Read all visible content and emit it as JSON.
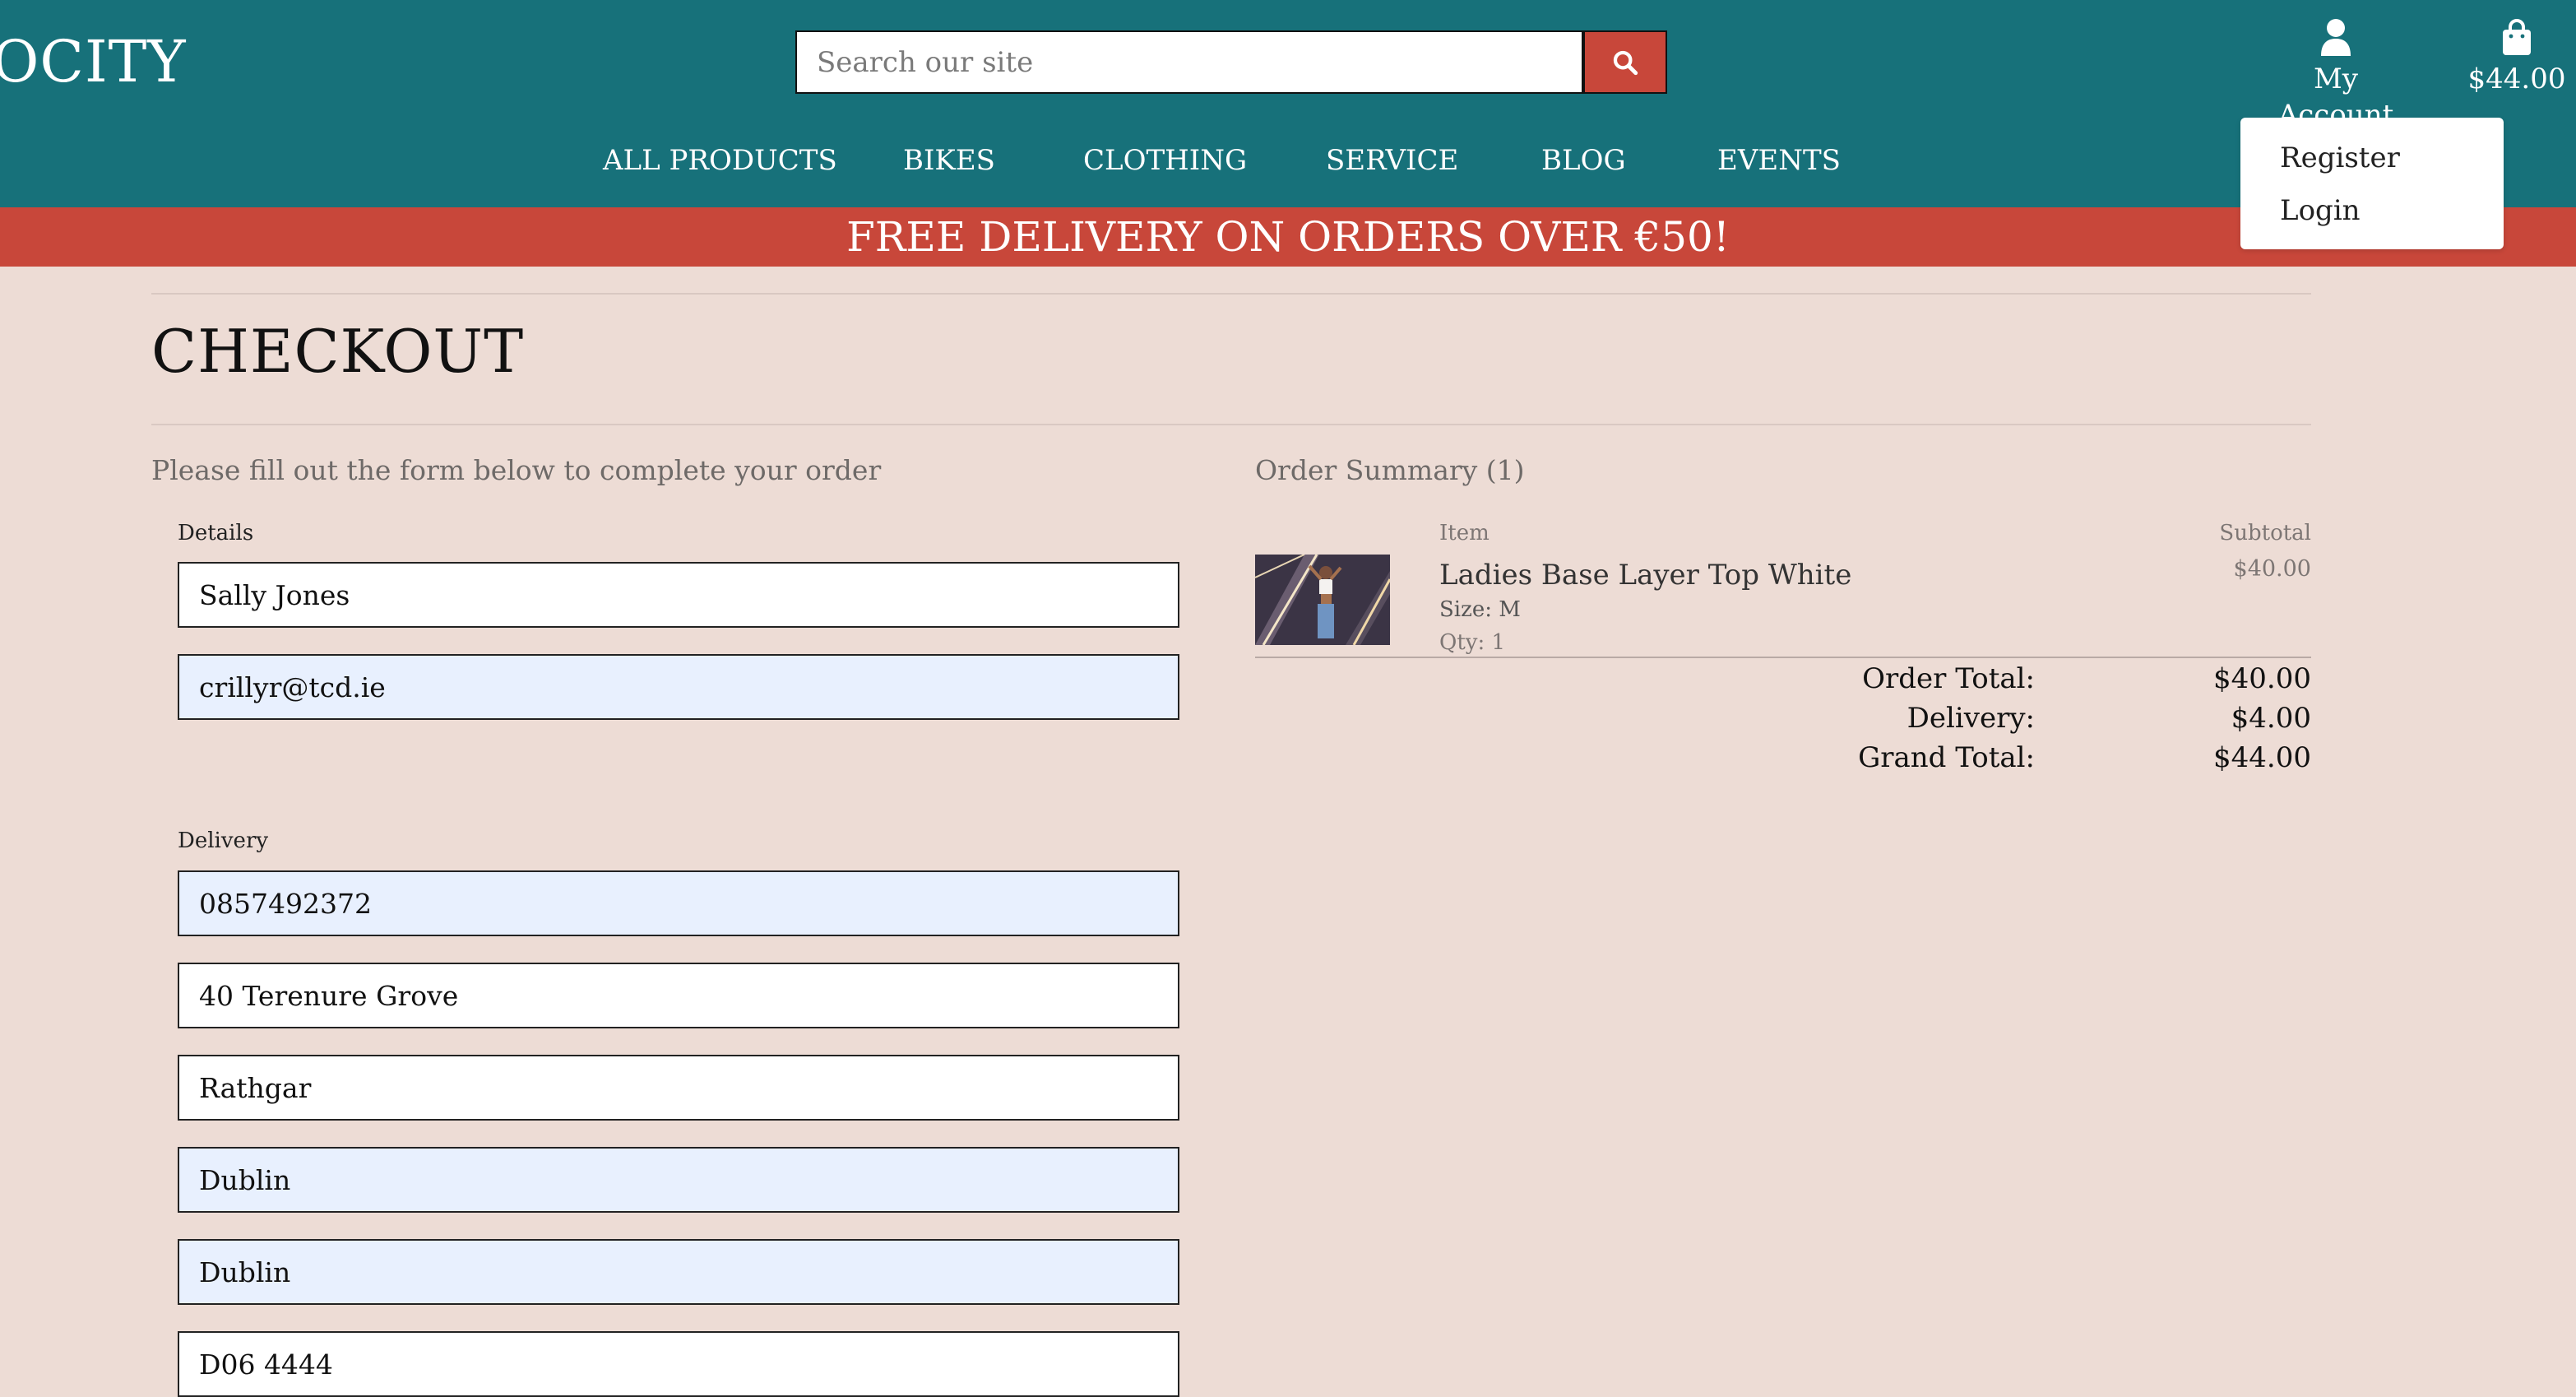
{
  "header": {
    "logo_text": "OCITY",
    "search": {
      "placeholder": "Search our site",
      "button_icon": "search-icon"
    },
    "account": {
      "icon": "user-icon",
      "label": "My Account"
    },
    "bag": {
      "icon": "shopping-bag-icon",
      "total": "$44.00"
    },
    "nav": [
      "ALL PRODUCTS",
      "BIKES",
      "CLOTHING",
      "SERVICE",
      "BLOG",
      "EVENTS"
    ],
    "account_menu": [
      "Register",
      "Login"
    ]
  },
  "banner": "FREE DELIVERY ON ORDERS OVER €50!",
  "page": {
    "title": "CHECKOUT",
    "lead": "Please fill out the form below to complete your order"
  },
  "form": {
    "details_label": "Details",
    "full_name": "Sally Jones",
    "email": "crillyr@tcd.ie",
    "delivery_label": "Delivery",
    "phone": "0857492372",
    "street_address": "40 Terenure Grove",
    "town": "Rathgar",
    "county": "Dublin",
    "city": "Dublin",
    "postcode": "D06 4444"
  },
  "order_summary": {
    "title": "Order Summary (1)",
    "item_header": "Item",
    "subtotal_header": "Subtotal",
    "items": [
      {
        "name": "Ladies Base Layer Top White",
        "size": "Size: M",
        "qty": "Qty: 1",
        "subtotal": "$40.00"
      }
    ],
    "order_total_label": "Order Total:",
    "order_total": "$40.00",
    "delivery_label": "Delivery:",
    "delivery": "$4.00",
    "grand_total_label": "Grand Total:",
    "grand_total": "$44.00"
  },
  "colors": {
    "header_bg": "#17717a",
    "accent_red": "#c8473a",
    "page_bg": "#eddcd5",
    "autofill_bg": "#e8f0fe"
  }
}
